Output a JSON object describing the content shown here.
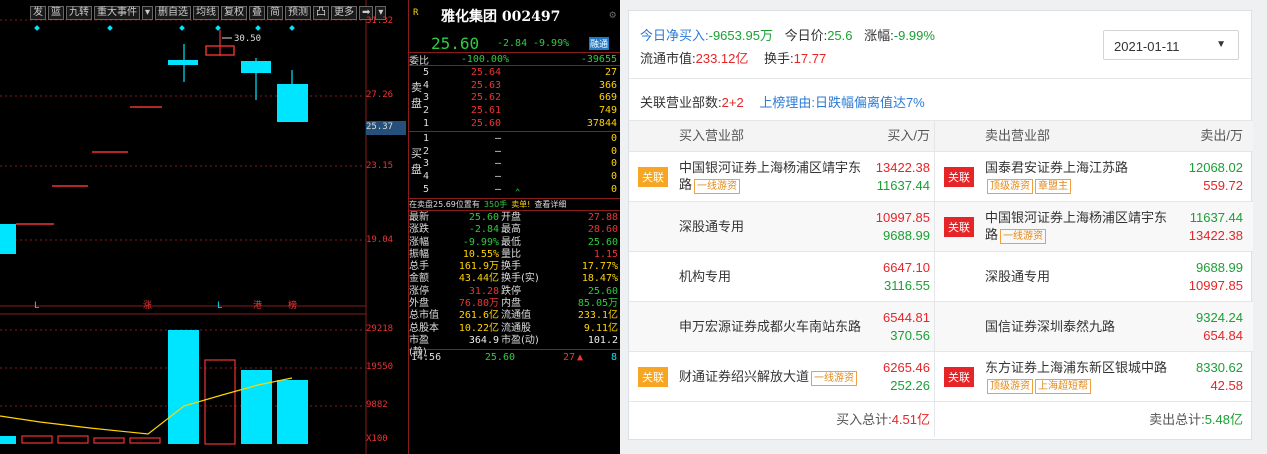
{
  "terminal": {
    "toolbar": [
      "发",
      "篮",
      "九转",
      "重大事件",
      "▾",
      "删自选",
      "均线",
      "复权",
      "叠",
      "简",
      "预测",
      "凸",
      "更多",
      "➡",
      "▾"
    ],
    "axis_labels": [
      "31.32",
      "27.26",
      "25.37",
      "23.15",
      "19.04",
      "29218",
      "19550",
      "9882",
      "X100"
    ],
    "high_marker": "30.50",
    "markers": {
      "l1": "L",
      "zhang": "涨",
      "l2": "L",
      "gang": "港",
      "bang": "榜"
    },
    "stock": {
      "title": "雅化集团 002497",
      "r": "R",
      "price": "25.60",
      "change": "-2.84",
      "change_pct": "-9.99%",
      "badge": "融通"
    },
    "weibi": {
      "label": "委比",
      "pct": "-100.00%",
      "diff": "-39655"
    },
    "sell_label": "卖盘",
    "buy_label": "买盘",
    "sell_orders": [
      {
        "n": "5",
        "price": "25.64",
        "vol": "27"
      },
      {
        "n": "4",
        "price": "25.63",
        "vol": "366"
      },
      {
        "n": "3",
        "price": "25.62",
        "vol": "669"
      },
      {
        "n": "2",
        "price": "25.61",
        "vol": "749"
      },
      {
        "n": "1",
        "price": "25.60",
        "vol": "37844"
      }
    ],
    "buy_orders": [
      {
        "n": "1",
        "price": "–",
        "vol": "0"
      },
      {
        "n": "2",
        "price": "–",
        "vol": "0"
      },
      {
        "n": "3",
        "price": "–",
        "vol": "0"
      },
      {
        "n": "4",
        "price": "–",
        "vol": "0"
      },
      {
        "n": "5",
        "price": "–",
        "vol": "0"
      }
    ],
    "notice": {
      "a": "在卖盘25.69位置有",
      "b": "350手",
      "c": "卖单!",
      "d": "查看详细"
    },
    "stats": [
      [
        "最新",
        "25.60",
        "开盘",
        "27.88"
      ],
      [
        "涨跌",
        "-2.84",
        "最高",
        "28.60"
      ],
      [
        "涨幅",
        "-9.99%",
        "最低",
        "25.60"
      ],
      [
        "振幅",
        "10.55%",
        "量比",
        "1.15"
      ],
      [
        "总手",
        "161.9万",
        "换手",
        "17.77%"
      ],
      [
        "金额",
        "43.44亿",
        "换手(实)",
        "18.47%"
      ],
      [
        "涨停",
        "31.28",
        "跌停",
        "25.60"
      ],
      [
        "外盘",
        "76.80万",
        "内盘",
        "85.05万"
      ],
      [
        "总市值",
        "261.6亿",
        "流通值",
        "233.1亿"
      ],
      [
        "总股本",
        "10.22亿",
        "流通股",
        "9.11亿"
      ],
      [
        "市盈(静)",
        "364.9",
        "市盈(动)",
        "101.2"
      ]
    ],
    "tick": {
      "time": "14:56",
      "price": "25.60",
      "vol": "27",
      "arrow": "▲",
      "n": "8"
    }
  },
  "panel": {
    "net_buy_label": "今日净买入:",
    "net_buy": "-9653.95万",
    "price_label": "今日价:",
    "price": "25.6",
    "chg_label": "涨幅:",
    "chg": "-9.99%",
    "float_label": "流通市值:",
    "float_val": "233.12亿",
    "turn_label": "换手:",
    "turn": "17.77",
    "date": "2021-01-11",
    "dept_label": "关联营业部数:",
    "dept_count": "2+2",
    "reason_label": "上榜理由:",
    "reason": "日跌幅偏离值达7%",
    "headers": {
      "buy_dept": "买入营业部",
      "buy_amt": "买入/万",
      "sell_dept": "卖出营业部",
      "sell_amt": "卖出/万"
    },
    "rows": [
      {
        "btag": "关联",
        "bname": "中国银河证券上海杨浦区靖宇东路",
        "bbadges": [
          "一线游资"
        ],
        "b1": "13422.38",
        "b2": "11637.44",
        "stag": "关联",
        "sname": "国泰君安证券上海江苏路",
        "sbadges": [
          "顶级游资",
          "章盟主"
        ],
        "s1": "12068.02",
        "s2": "559.72"
      },
      {
        "btag": "",
        "bname": "深股通专用",
        "bbadges": [],
        "b1": "10997.85",
        "b2": "9688.99",
        "stag": "关联",
        "sname": "中国银河证券上海杨浦区靖宇东路",
        "sbadges": [
          "一线游资"
        ],
        "s1": "11637.44",
        "s2": "13422.38"
      },
      {
        "btag": "",
        "bname": "机构专用",
        "bbadges": [],
        "b1": "6647.10",
        "b2": "3116.55",
        "stag": "",
        "sname": "深股通专用",
        "sbadges": [],
        "s1": "9688.99",
        "s2": "10997.85"
      },
      {
        "btag": "",
        "bname": "申万宏源证券成都火车南站东路",
        "bbadges": [],
        "b1": "6544.81",
        "b2": "370.56",
        "stag": "",
        "sname": "国信证券深圳泰然九路",
        "sbadges": [],
        "s1": "9324.24",
        "s2": "654.84"
      },
      {
        "btag": "关联",
        "bname": "财通证券绍兴解放大道",
        "bbadges": [
          "一线游资"
        ],
        "b1": "6265.46",
        "b2": "252.26",
        "stag": "关联",
        "sname": "东方证券上海浦东新区银城中路",
        "sbadges": [
          "顶级游资",
          "上海超短帮"
        ],
        "s1": "8330.62",
        "s2": "42.58"
      }
    ],
    "buy_total_label": "买入总计:",
    "buy_total": "4.51亿",
    "sell_total_label": "卖出总计:",
    "sell_total": "5.48亿"
  },
  "colors": {
    "up": "#e33",
    "down": "#2ecc40",
    "cyan": "#00e5ff",
    "panel_red": "#e62528",
    "panel_green": "#1aa034",
    "link": "#2b7bd6"
  }
}
